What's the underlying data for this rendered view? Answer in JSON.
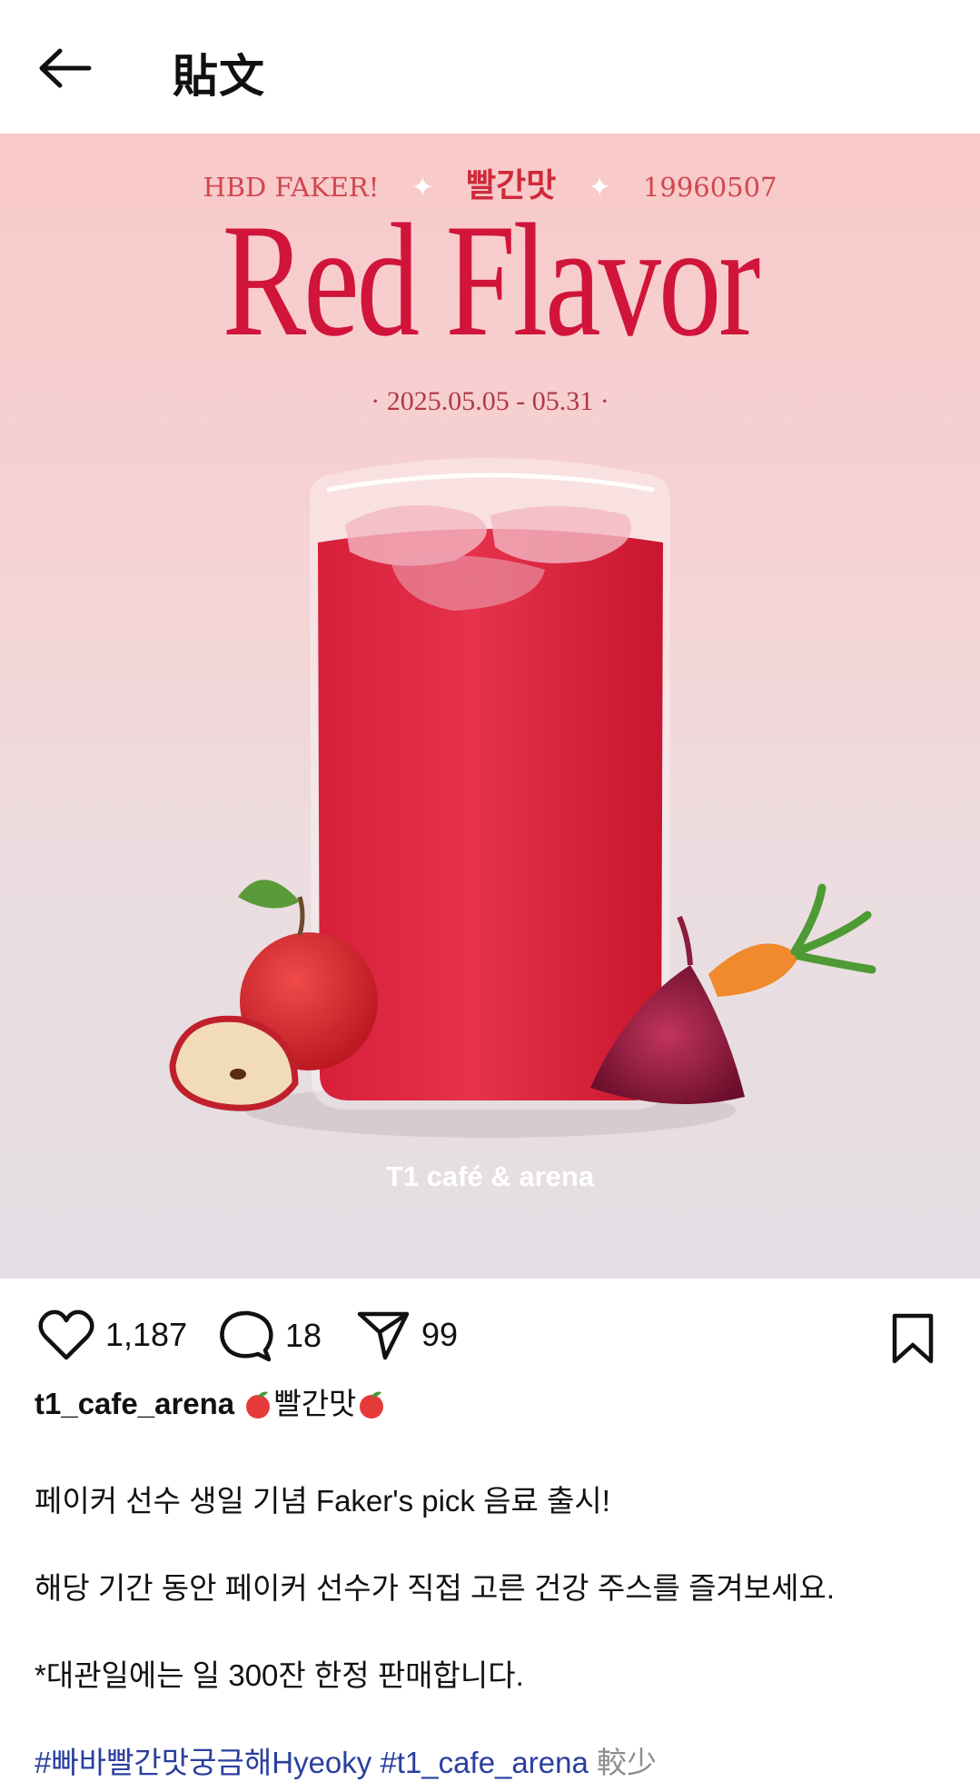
{
  "header": {
    "title": "貼文"
  },
  "post_image": {
    "promo_left": "HBD FAKER!",
    "promo_center": "빨간맛",
    "promo_right": "19960507",
    "headline": "Red Flavor",
    "date_range": "· 2025.05.05 - 05.31 ·",
    "watermark": "T1 café & arena"
  },
  "actions": {
    "likes": "1,187",
    "comments": "18",
    "shares": "99"
  },
  "caption": {
    "username": "t1_cafe_arena",
    "title_text": "빨간맛",
    "line1": "페이커 선수 생일 기념 Faker's pick 음료 출시!",
    "line2": "해당 기간 동안 페이커 선수가 직접 고른 건강 주스를 즐겨보세요.",
    "line3": "*대관일에는 일 300잔 한정 판매합니다.",
    "hashtag1": "#빠바빨간맛궁금해Hyeoky",
    "hashtag2": "#t1_cafe_arena",
    "more": "較少"
  },
  "icons": [
    "back-arrow-icon",
    "heart-icon",
    "comment-icon",
    "send-icon",
    "bookmark-icon",
    "apple-emoji-icon"
  ],
  "colors": {
    "headline": "#d0143a",
    "hashtag": "#2a3f9e",
    "more": "#8e8e8e"
  }
}
